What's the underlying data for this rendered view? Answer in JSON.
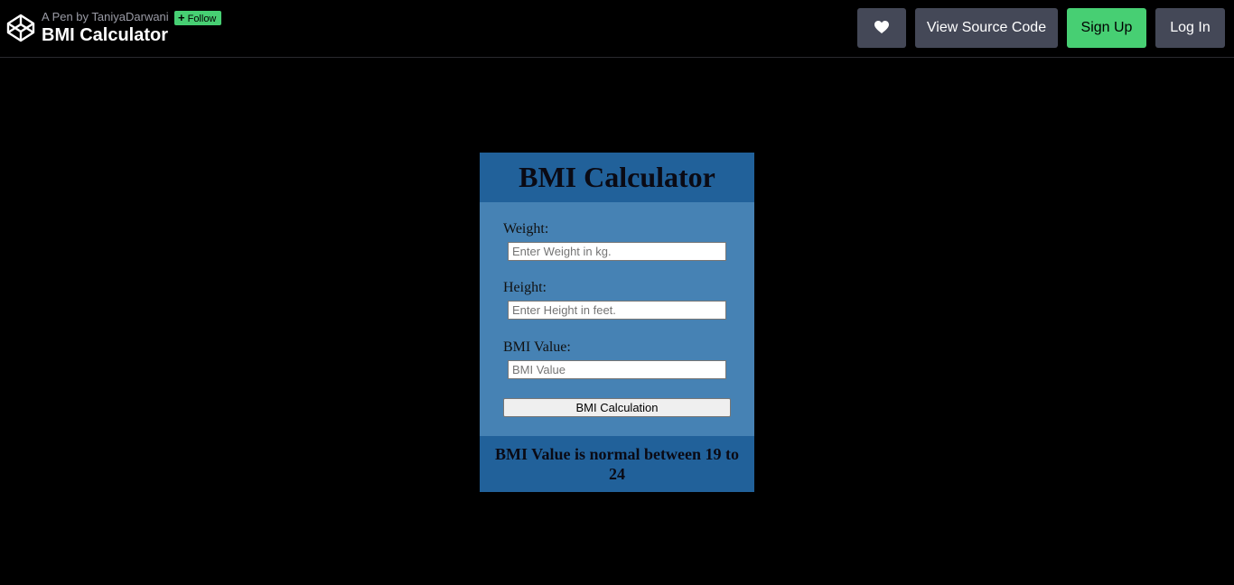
{
  "header": {
    "pen_by": "A Pen by TaniyaDarwani",
    "follow_label": "Follow",
    "pen_title": "BMI Calculator",
    "buttons": {
      "view_source": "View Source Code",
      "sign_up": "Sign Up",
      "log_in": "Log In"
    }
  },
  "calculator": {
    "title": "BMI Calculator",
    "weight_label": "Weight:",
    "weight_placeholder": "Enter Weight in kg.",
    "height_label": "Height:",
    "height_placeholder": "Enter Height in feet.",
    "bmi_label": "BMI Value:",
    "bmi_placeholder": "BMI Value",
    "calc_button": "BMI Calculation",
    "footer_note": "BMI Value is normal between 19 to 24"
  },
  "colors": {
    "accent_green": "#47cf73",
    "button_gray": "#444857",
    "card_blue": "#4682b4",
    "card_dark_blue": "#21619a"
  },
  "icons": [
    "codepen-logo-icon",
    "plus-icon",
    "heart-icon"
  ]
}
